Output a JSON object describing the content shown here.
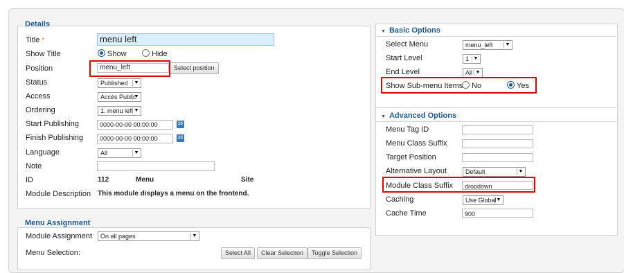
{
  "details": {
    "legend": "Details",
    "title_label": "Title",
    "title_required": "*",
    "title_value": "menu left",
    "show_title_label": "Show Title",
    "show_option": "Show",
    "hide_option": "Hide",
    "position_label": "Position",
    "position_value": "menu_left",
    "select_position_button": "Select position",
    "status_label": "Status",
    "status_value": "Published",
    "access_label": "Access",
    "access_value": "Accès Public",
    "ordering_label": "Ordering",
    "ordering_value": "1. menu left",
    "start_publishing_label": "Start Publishing",
    "start_publishing_value": "0000-00-00 00:00:00",
    "finish_publishing_label": "Finish Publishing",
    "finish_publishing_value": "0000-00-00 00:00:00",
    "calendar_icon_text": "23",
    "language_label": "Language",
    "language_value": "All",
    "note_label": "Note",
    "note_value": "",
    "id_label": "ID",
    "id_value": "112",
    "id_type": "Menu",
    "id_client": "Site",
    "description_label": "Module Description",
    "description_value": "This module displays a menu on the frontend."
  },
  "menu_assignment": {
    "legend": "Menu Assignment",
    "assignment_label": "Module Assignment",
    "assignment_value": "On all pages",
    "selection_label": "Menu Selection:",
    "select_all": "Select All",
    "clear_selection": "Clear Selection",
    "toggle_selection": "Toggle Selection"
  },
  "basic_options": {
    "title": "Basic Options",
    "select_menu_label": "Select Menu",
    "select_menu_value": "menu_left",
    "start_level_label": "Start Level",
    "start_level_value": "1",
    "end_level_label": "End Level",
    "end_level_value": "All",
    "show_submenu_label": "Show Sub-menu Items",
    "no_option": "No",
    "yes_option": "Yes"
  },
  "advanced_options": {
    "title": "Advanced Options",
    "menu_tag_id_label": "Menu Tag ID",
    "menu_tag_id_value": "",
    "menu_class_suffix_label": "Menu Class Suffix",
    "menu_class_suffix_value": "",
    "target_position_label": "Target Position",
    "target_position_value": "",
    "alternative_layout_label": "Alternative Layout",
    "alternative_layout_value": "Default",
    "module_class_suffix_label": "Module Class Suffix",
    "module_class_suffix_value": "dropdown",
    "caching_label": "Caching",
    "caching_value": "Use Global",
    "cache_time_label": "Cache Time",
    "cache_time_value": "900"
  },
  "colors": {
    "accent": "#1f5b8f",
    "highlight": "#e00000",
    "title_field_bg": "#dbeefe"
  }
}
